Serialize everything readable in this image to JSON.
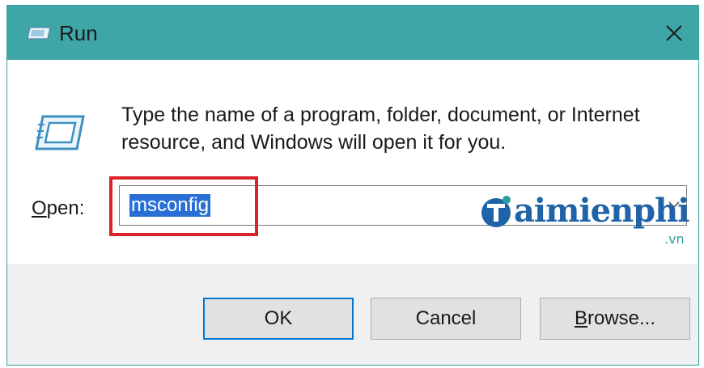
{
  "window": {
    "title": "Run",
    "icon": "run-app-icon",
    "close_glyph": "✕"
  },
  "dialog": {
    "description_line1": "Type the name of a program, folder, document, or Internet",
    "description_line2": "resource, and Windows will open it for you.",
    "open_label_accel": "O",
    "open_label_rest": "pen:",
    "open_value": "msconfig",
    "dropdown_icon": "chevron-down-icon"
  },
  "buttons": {
    "ok_label": "OK",
    "cancel_label": "Cancel",
    "browse_accel": "B",
    "browse_rest": "rowse..."
  },
  "watermark": {
    "text": "aimienphi",
    "sub": ".vn"
  },
  "colors": {
    "titlebar": "#3fa6a8",
    "selection": "#2a6fd6",
    "highlight": "#d8232a",
    "default_button_border": "#0078d7",
    "watermark": "#1f63a8"
  }
}
